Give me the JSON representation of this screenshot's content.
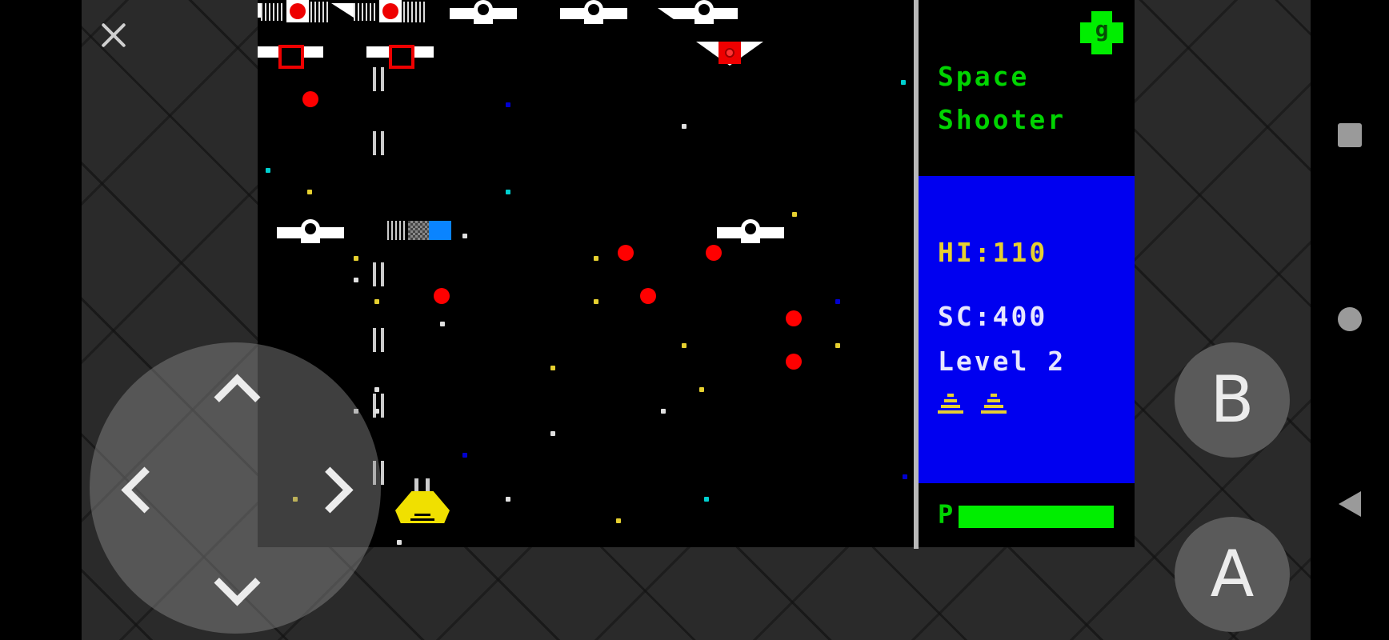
{
  "game": {
    "title_line1": "Space",
    "title_line2": "Shooter",
    "badge_letter": "g",
    "hi_score_text": "HI:110",
    "score_text": "SC:400",
    "level_text": "Level 2",
    "lives_remaining": 2,
    "power_label": "P",
    "power_level_percent": 100
  },
  "controls": {
    "close_icon": "close-icon",
    "dpad_icons": [
      "chevron-up-icon",
      "chevron-down-icon",
      "chevron-left-icon",
      "chevron-right-icon"
    ],
    "button_b_label": "B",
    "button_a_label": "A"
  },
  "system_nav": {
    "icons": [
      "recents-square-icon",
      "home-circle-icon",
      "back-triangle-icon"
    ]
  },
  "colors": {
    "title_green": "#00d400",
    "panel_blue": "#0000f0",
    "hi_yellow": "#e6d030",
    "score_white": "#e6e6ff",
    "power_green": "#00ee00",
    "enemy_bullet_red": "#ff0000",
    "player_yellow": "#f0e000"
  }
}
